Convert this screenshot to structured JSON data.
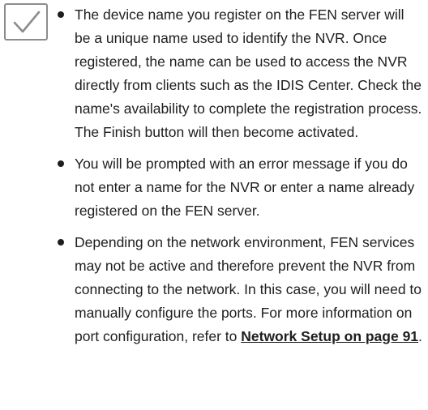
{
  "note_icon": "checkmark-icon",
  "bullets": [
    {
      "text": "The device name you register on the FEN server will be a unique name used to identify the NVR. Once registered, the name can be used to access the NVR directly from clients such as the IDIS Center. Check the name's availability to complete the registration process. The Finish button will then become activated."
    },
    {
      "text": "You will be prompted with an error message if you do not enter a name for the NVR or enter a name already registered on the FEN server."
    },
    {
      "text_before": "Depending on the network environment, FEN services may not be active and therefore prevent the NVR from connecting to the network. In this case, you will need to manually configure the ports. For more information on port configuration, refer to ",
      "link": "Network Setup on page 91",
      "text_after": "."
    }
  ]
}
